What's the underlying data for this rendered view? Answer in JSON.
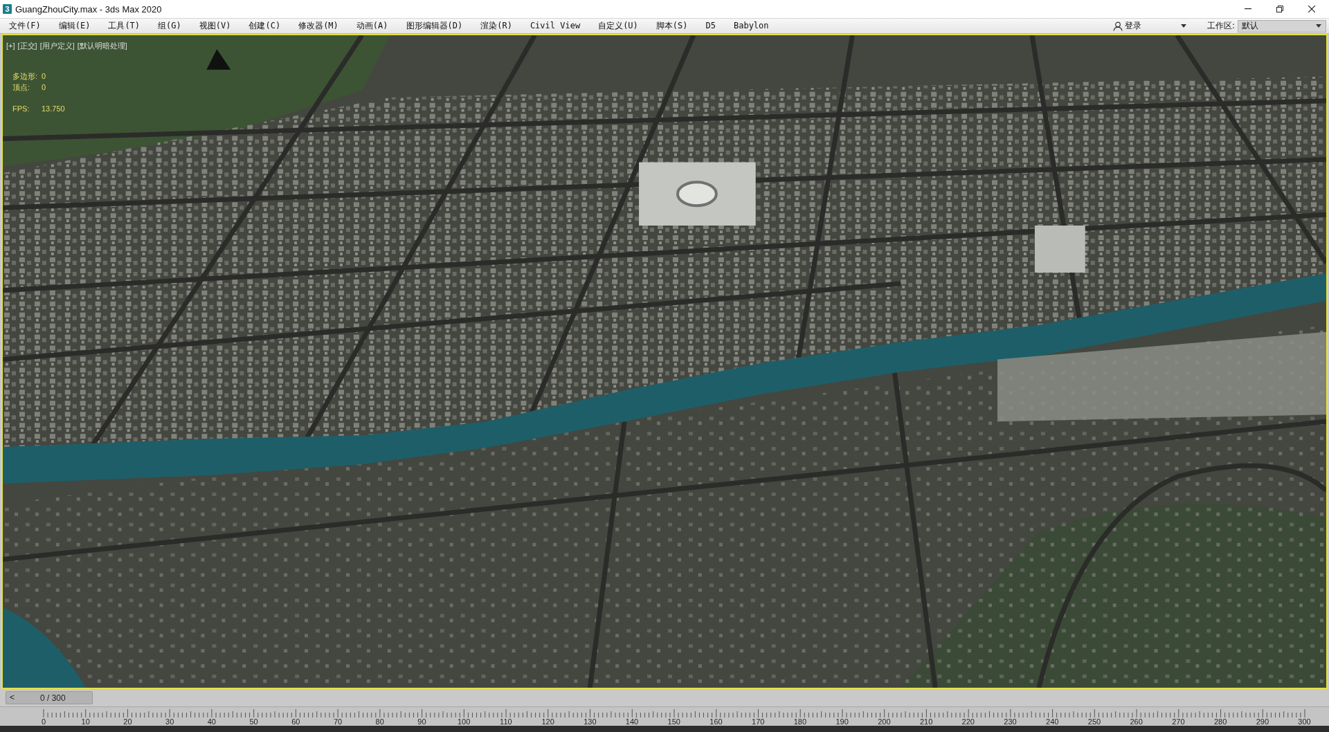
{
  "window": {
    "app_icon": "3",
    "title": "GuangZhouCity.max - 3ds Max 2020"
  },
  "menu_bar": {
    "items": [
      "文件(F)",
      "编辑(E)",
      "工具(T)",
      "组(G)",
      "视图(V)",
      "创建(C)",
      "修改器(M)",
      "动画(A)",
      "图形编辑器(D)",
      "渲染(R)",
      "Civil View",
      "自定义(U)",
      "脚本(S)",
      "D5",
      "Babylon"
    ],
    "sign_in": "登录",
    "workspace_label": "工作区:",
    "workspace_value": "默认"
  },
  "viewport": {
    "active": true,
    "labels": [
      "[+]",
      "[正交]",
      "[用户定义]",
      "[默认明暗处理]"
    ],
    "stats": [
      {
        "label": "多边形:",
        "value": "0"
      },
      {
        "label": "顶点:",
        "value": "0"
      }
    ],
    "fps": {
      "label": "FPS:",
      "value": "13.750"
    }
  },
  "time_slider": {
    "prev_button": "<",
    "frame": "0 / 300",
    "level": 0
  },
  "track_bar": {
    "labels": [
      "0",
      "10",
      "20",
      "30",
      "40",
      "50",
      "60",
      "70",
      "80",
      "90",
      "100",
      "110",
      "120",
      "130",
      "140",
      "150",
      "160",
      "170",
      "180",
      "190",
      "200",
      "210",
      "220",
      "230",
      "240",
      "250",
      "260",
      "270",
      "280",
      "290",
      "300"
    ]
  }
}
